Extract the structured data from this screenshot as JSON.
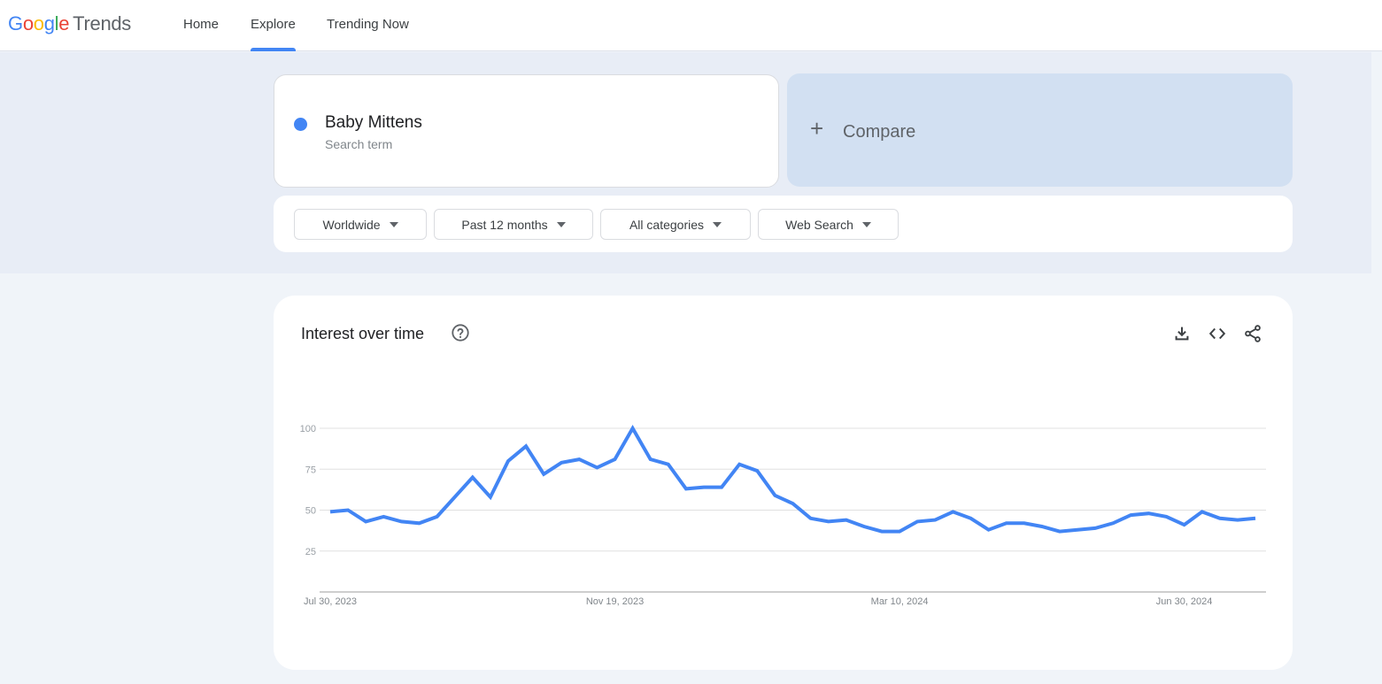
{
  "header": {
    "logo": {
      "google_letters": [
        "G",
        "o",
        "o",
        "g",
        "l",
        "e"
      ],
      "product": "Trends"
    },
    "nav": [
      {
        "label": "Home",
        "active": false
      },
      {
        "label": "Explore",
        "active": true
      },
      {
        "label": "Trending Now",
        "active": false
      }
    ]
  },
  "search": {
    "term": "Baby Mittens",
    "term_type": "Search term",
    "term_color": "#4285f4",
    "compare_label": "Compare",
    "compare_icon": "plus-icon"
  },
  "filters": [
    {
      "label": "Worldwide",
      "icon": "caret-down-icon"
    },
    {
      "label": "Past 12 months",
      "icon": "caret-down-icon"
    },
    {
      "label": "All categories",
      "icon": "caret-down-icon"
    },
    {
      "label": "Web Search",
      "icon": "caret-down-icon"
    }
  ],
  "chart_panel": {
    "title": "Interest over time",
    "help_icon": "help-circle-icon",
    "actions": [
      {
        "name": "download-icon",
        "label": "Download CSV"
      },
      {
        "name": "embed-icon",
        "label": "Embed"
      },
      {
        "name": "share-icon",
        "label": "Share"
      }
    ]
  },
  "chart_data": {
    "type": "line",
    "title": "Interest over time",
    "xlabel": "",
    "ylabel": "",
    "ylim": [
      0,
      100
    ],
    "yticks": [
      25,
      50,
      75,
      100
    ],
    "xtick_labels": [
      {
        "label": "Jul 30, 2023",
        "index": 0
      },
      {
        "label": "Nov 19, 2023",
        "index": 16
      },
      {
        "label": "Mar 10, 2024",
        "index": 32
      },
      {
        "label": "Jun 30, 2024",
        "index": 48
      }
    ],
    "grid": true,
    "legend": "none",
    "series": [
      {
        "name": "Baby Mittens",
        "color": "#4285f4",
        "values": [
          49,
          50,
          43,
          46,
          43,
          42,
          46,
          58,
          70,
          58,
          80,
          89,
          72,
          79,
          81,
          76,
          81,
          100,
          81,
          78,
          63,
          64,
          64,
          78,
          74,
          59,
          54,
          45,
          43,
          44,
          40,
          37,
          37,
          43,
          44,
          49,
          45,
          38,
          42,
          42,
          40,
          37,
          38,
          39,
          42,
          47,
          48,
          46,
          41,
          49,
          45,
          44,
          45
        ]
      }
    ]
  }
}
